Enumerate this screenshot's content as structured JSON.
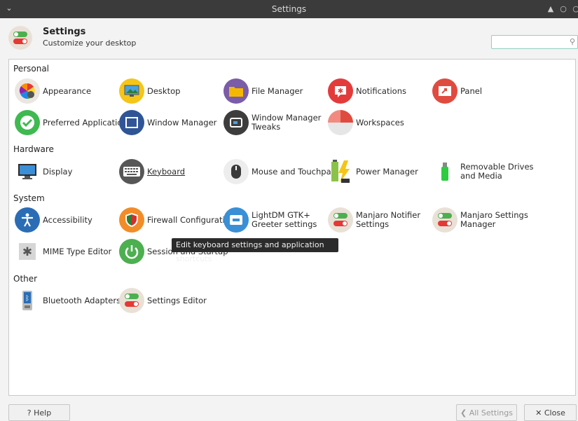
{
  "window": {
    "title": "Settings"
  },
  "header": {
    "title": "Settings",
    "subtitle": "Customize your desktop",
    "search_placeholder": ""
  },
  "sections": {
    "personal": "Personal",
    "hardware": "Hardware",
    "system": "System",
    "other": "Other"
  },
  "items": {
    "appearance": "Appearance",
    "desktop": "Desktop",
    "file_manager": "File Manager",
    "notifications": "Notifications",
    "panel": "Panel",
    "preferred_apps": "Preferred Applications",
    "window_manager": "Window Manager",
    "wm_tweaks_1": "Window Manager",
    "wm_tweaks_2": "Tweaks",
    "workspaces": "Workspaces",
    "display": "Display",
    "keyboard": "Keyboard",
    "mouse": "Mouse and Touchpad",
    "power": "Power Manager",
    "removable_1": "Removable Drives",
    "removable_2": "and Media",
    "accessibility": "Accessibility",
    "firewall": "Firewall Configuration",
    "lightdm_1": "LightDM GTK+",
    "lightdm_2": "Greeter settings",
    "manjaro_notifier_1": "Manjaro Notifier",
    "manjaro_notifier_2": "Settings",
    "manjaro_settings_1": "Manjaro Settings",
    "manjaro_settings_2": "Manager",
    "mime": "MIME Type Editor",
    "session": "Session and Startup",
    "bluetooth": "Bluetooth Adapters",
    "settings_editor": "Settings Editor"
  },
  "tooltip": "Edit keyboard settings and application shortcuts",
  "footer": {
    "help": "? Help",
    "all_settings": "❮ All Settings",
    "close": "✕ Close"
  },
  "colors": {
    "titlebar": "#3b3b3b",
    "accent": "#8fd0c0",
    "toggle_green": "#4caf50",
    "toggle_red": "#e53935"
  }
}
